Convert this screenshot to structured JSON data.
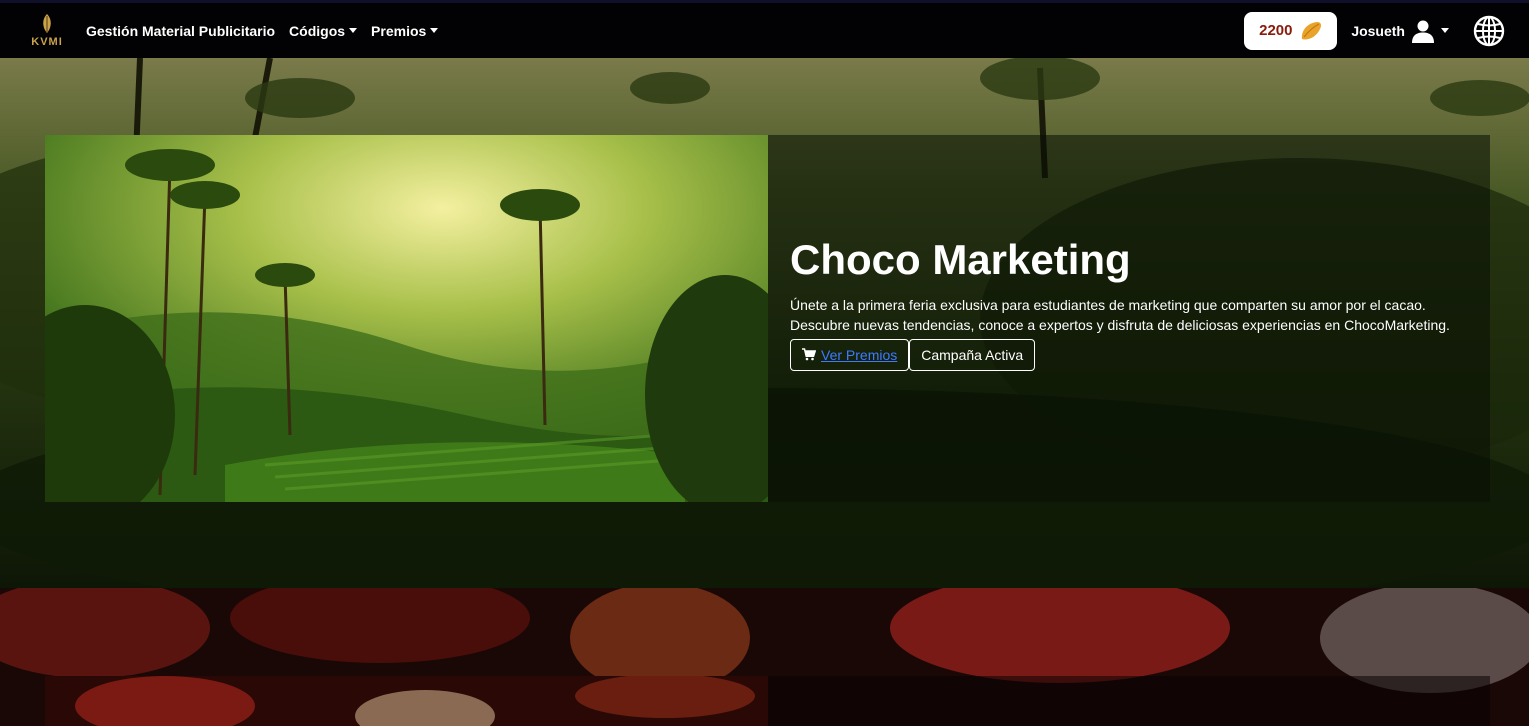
{
  "navbar": {
    "brand": "KVMI",
    "links": [
      {
        "label": "Gestión Material Publicitario",
        "dropdown": false
      },
      {
        "label": "Códigos",
        "dropdown": true
      },
      {
        "label": "Premios",
        "dropdown": true
      }
    ],
    "points": "2200",
    "user": "Josueth"
  },
  "campaign": {
    "title": "Choco Marketing",
    "description": "Únete a la primera feria exclusiva para estudiantes de marketing que comparten su amor por el cacao. Descubre nuevas tendencias, conoce a expertos y disfruta de deliciosas experiencias en ChocoMarketing.",
    "view_prizes_label": "Ver Premios",
    "status_label": "Campaña Activa"
  },
  "colors": {
    "points_text": "#8a1a0c",
    "brand_gold": "#c9a24a",
    "link_blue": "#3d7bff"
  }
}
